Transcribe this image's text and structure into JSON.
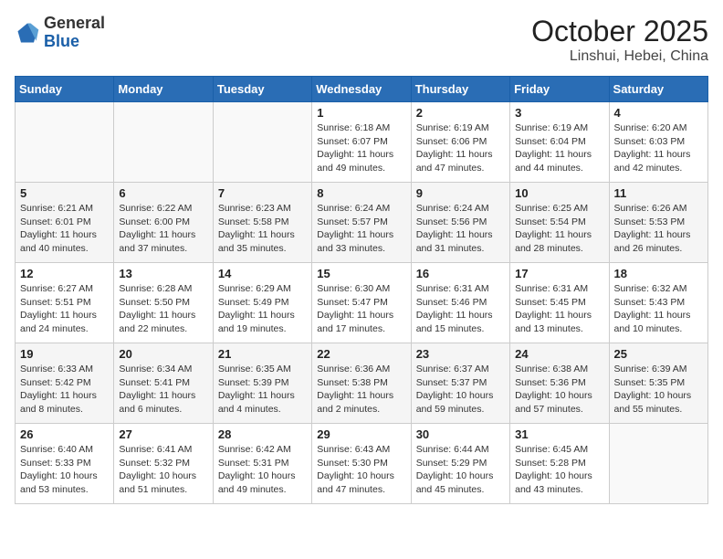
{
  "header": {
    "logo_line1": "General",
    "logo_line2": "Blue",
    "title": "October 2025",
    "subtitle": "Linshui, Hebei, China"
  },
  "weekdays": [
    "Sunday",
    "Monday",
    "Tuesday",
    "Wednesday",
    "Thursday",
    "Friday",
    "Saturday"
  ],
  "weeks": [
    [
      {
        "day": "",
        "detail": ""
      },
      {
        "day": "",
        "detail": ""
      },
      {
        "day": "",
        "detail": ""
      },
      {
        "day": "1",
        "detail": "Sunrise: 6:18 AM\nSunset: 6:07 PM\nDaylight: 11 hours\nand 49 minutes."
      },
      {
        "day": "2",
        "detail": "Sunrise: 6:19 AM\nSunset: 6:06 PM\nDaylight: 11 hours\nand 47 minutes."
      },
      {
        "day": "3",
        "detail": "Sunrise: 6:19 AM\nSunset: 6:04 PM\nDaylight: 11 hours\nand 44 minutes."
      },
      {
        "day": "4",
        "detail": "Sunrise: 6:20 AM\nSunset: 6:03 PM\nDaylight: 11 hours\nand 42 minutes."
      }
    ],
    [
      {
        "day": "5",
        "detail": "Sunrise: 6:21 AM\nSunset: 6:01 PM\nDaylight: 11 hours\nand 40 minutes."
      },
      {
        "day": "6",
        "detail": "Sunrise: 6:22 AM\nSunset: 6:00 PM\nDaylight: 11 hours\nand 37 minutes."
      },
      {
        "day": "7",
        "detail": "Sunrise: 6:23 AM\nSunset: 5:58 PM\nDaylight: 11 hours\nand 35 minutes."
      },
      {
        "day": "8",
        "detail": "Sunrise: 6:24 AM\nSunset: 5:57 PM\nDaylight: 11 hours\nand 33 minutes."
      },
      {
        "day": "9",
        "detail": "Sunrise: 6:24 AM\nSunset: 5:56 PM\nDaylight: 11 hours\nand 31 minutes."
      },
      {
        "day": "10",
        "detail": "Sunrise: 6:25 AM\nSunset: 5:54 PM\nDaylight: 11 hours\nand 28 minutes."
      },
      {
        "day": "11",
        "detail": "Sunrise: 6:26 AM\nSunset: 5:53 PM\nDaylight: 11 hours\nand 26 minutes."
      }
    ],
    [
      {
        "day": "12",
        "detail": "Sunrise: 6:27 AM\nSunset: 5:51 PM\nDaylight: 11 hours\nand 24 minutes."
      },
      {
        "day": "13",
        "detail": "Sunrise: 6:28 AM\nSunset: 5:50 PM\nDaylight: 11 hours\nand 22 minutes."
      },
      {
        "day": "14",
        "detail": "Sunrise: 6:29 AM\nSunset: 5:49 PM\nDaylight: 11 hours\nand 19 minutes."
      },
      {
        "day": "15",
        "detail": "Sunrise: 6:30 AM\nSunset: 5:47 PM\nDaylight: 11 hours\nand 17 minutes."
      },
      {
        "day": "16",
        "detail": "Sunrise: 6:31 AM\nSunset: 5:46 PM\nDaylight: 11 hours\nand 15 minutes."
      },
      {
        "day": "17",
        "detail": "Sunrise: 6:31 AM\nSunset: 5:45 PM\nDaylight: 11 hours\nand 13 minutes."
      },
      {
        "day": "18",
        "detail": "Sunrise: 6:32 AM\nSunset: 5:43 PM\nDaylight: 11 hours\nand 10 minutes."
      }
    ],
    [
      {
        "day": "19",
        "detail": "Sunrise: 6:33 AM\nSunset: 5:42 PM\nDaylight: 11 hours\nand 8 minutes."
      },
      {
        "day": "20",
        "detail": "Sunrise: 6:34 AM\nSunset: 5:41 PM\nDaylight: 11 hours\nand 6 minutes."
      },
      {
        "day": "21",
        "detail": "Sunrise: 6:35 AM\nSunset: 5:39 PM\nDaylight: 11 hours\nand 4 minutes."
      },
      {
        "day": "22",
        "detail": "Sunrise: 6:36 AM\nSunset: 5:38 PM\nDaylight: 11 hours\nand 2 minutes."
      },
      {
        "day": "23",
        "detail": "Sunrise: 6:37 AM\nSunset: 5:37 PM\nDaylight: 10 hours\nand 59 minutes."
      },
      {
        "day": "24",
        "detail": "Sunrise: 6:38 AM\nSunset: 5:36 PM\nDaylight: 10 hours\nand 57 minutes."
      },
      {
        "day": "25",
        "detail": "Sunrise: 6:39 AM\nSunset: 5:35 PM\nDaylight: 10 hours\nand 55 minutes."
      }
    ],
    [
      {
        "day": "26",
        "detail": "Sunrise: 6:40 AM\nSunset: 5:33 PM\nDaylight: 10 hours\nand 53 minutes."
      },
      {
        "day": "27",
        "detail": "Sunrise: 6:41 AM\nSunset: 5:32 PM\nDaylight: 10 hours\nand 51 minutes."
      },
      {
        "day": "28",
        "detail": "Sunrise: 6:42 AM\nSunset: 5:31 PM\nDaylight: 10 hours\nand 49 minutes."
      },
      {
        "day": "29",
        "detail": "Sunrise: 6:43 AM\nSunset: 5:30 PM\nDaylight: 10 hours\nand 47 minutes."
      },
      {
        "day": "30",
        "detail": "Sunrise: 6:44 AM\nSunset: 5:29 PM\nDaylight: 10 hours\nand 45 minutes."
      },
      {
        "day": "31",
        "detail": "Sunrise: 6:45 AM\nSunset: 5:28 PM\nDaylight: 10 hours\nand 43 minutes."
      },
      {
        "day": "",
        "detail": ""
      }
    ]
  ]
}
